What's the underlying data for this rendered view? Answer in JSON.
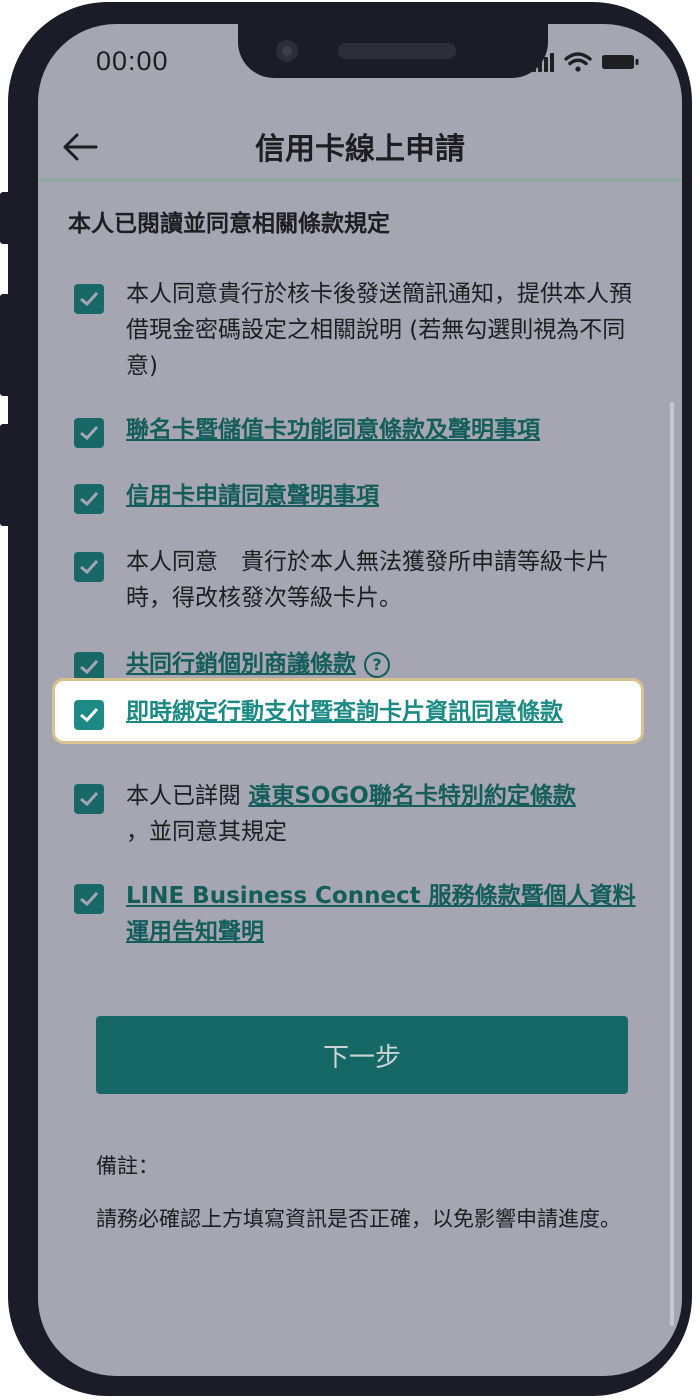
{
  "status_bar": {
    "time": "00:00"
  },
  "header": {
    "title": "信用卡線上申請"
  },
  "section_title": "本人已閱讀並同意相關條款規定",
  "items": [
    {
      "text": "本人同意貴行於核卡後發送簡訊通知，提供本人預借現金密碼設定之相關說明 (若無勾選則視為不同意)"
    },
    {
      "link": "聯名卡暨儲值卡功能同意條款及聲明事項"
    },
    {
      "link": "信用卡申請同意聲明事項"
    },
    {
      "text": "本人同意　貴行於本人無法獲發所申請等級卡片時，得改核發次等級卡片。"
    },
    {
      "link": "共同行銷個別商議條款",
      "help": "?"
    },
    {
      "link": "即時綁定行動支付暨查詢卡片資訊同意條款"
    },
    {
      "prefix": "本人已詳閱 ",
      "link": "遠東SOGO聯名卡特別約定條款",
      "suffix": "，並同意其規定"
    },
    {
      "link": "LINE Business Connect 服務條款暨個人資料運用告知聲明"
    }
  ],
  "next_button": "下一步",
  "note": {
    "label": "備註：",
    "text": "請務必確認上方填寫資訊是否正確，以免影響申請進度。"
  },
  "colors": {
    "accent": "#156866",
    "checkbox": "#176866",
    "highlight_border": "#dac28e",
    "overlay_bg": "#a6a5b2"
  }
}
